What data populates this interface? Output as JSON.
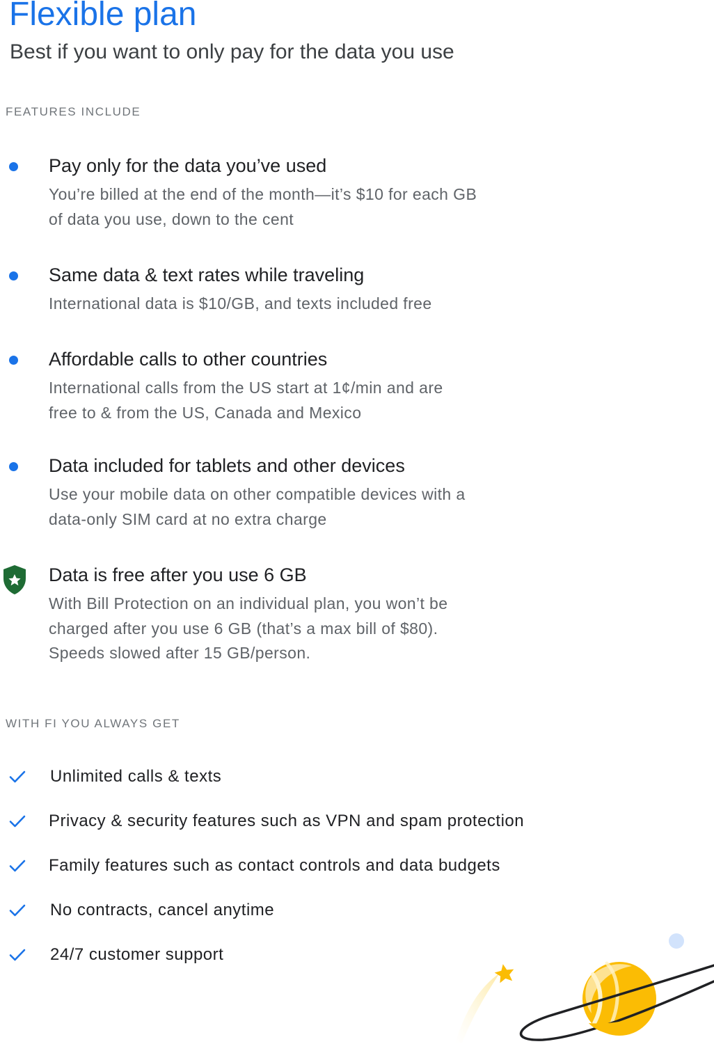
{
  "header": {
    "title": "Flexible plan",
    "subtitle": "Best if you want to only pay for the data you use"
  },
  "features_section": {
    "label": "FEATURES INCLUDE",
    "items": [
      {
        "icon": "bullet-dot-icon",
        "title": "Pay only for the data you’ve used",
        "description": "You’re billed at the end of the month—it’s $10 for each GB of data you use, down to the cent"
      },
      {
        "icon": "bullet-dot-icon",
        "title": "Same data & text rates while traveling",
        "description": "International data is $10/GB, and texts included free"
      },
      {
        "icon": "bullet-dot-icon",
        "title": "Affordable calls to other countries",
        "description": "International calls from the US start at 1¢/min and are free to & from the US, Canada and Mexico"
      },
      {
        "icon": "bullet-dot-icon",
        "title": "Data included for tablets and other devices",
        "description": "Use your mobile data on other compatible devices with a data-only SIM card at no extra charge"
      },
      {
        "icon": "shield-star-icon",
        "title": "Data is free after you use 6 GB",
        "description": "With Bill Protection on an individual plan, you won’t be charged after you use 6 GB (that’s a max bill of $80). Speeds slowed after 15 GB/person."
      }
    ]
  },
  "always_section": {
    "label": "WITH FI YOU ALWAYS GET",
    "items": [
      {
        "icon": "checkmark-icon",
        "text": "Unlimited calls & texts"
      },
      {
        "icon": "checkmark-icon",
        "text": "Privacy & security features such as VPN and spam protection"
      },
      {
        "icon": "checkmark-icon",
        "text": "Family features such as contact controls and data budgets"
      },
      {
        "icon": "checkmark-icon",
        "text": "No contracts, cancel anytime"
      },
      {
        "icon": "checkmark-icon",
        "text": "24/7 customer support"
      }
    ]
  },
  "colors": {
    "accent_blue": "#1a73e8",
    "shield_green": "#1e6b34",
    "planet_yellow": "#fbbc04",
    "text_primary": "#202124",
    "text_secondary": "#5f6368",
    "label_gray": "#70757a"
  },
  "illustration": {
    "icon": "planet-with-shooting-star-icon"
  }
}
